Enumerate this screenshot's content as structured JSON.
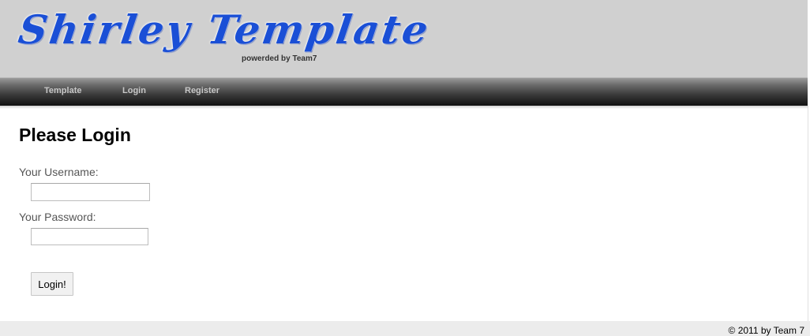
{
  "header": {
    "logo_title": "Shirley Template",
    "logo_subtitle": "powerded by Team7"
  },
  "nav": {
    "items": [
      {
        "label": "Template"
      },
      {
        "label": "Login"
      },
      {
        "label": "Register"
      }
    ]
  },
  "main": {
    "title": "Please Login",
    "username_label": "Your Username:",
    "username_value": "",
    "password_label": "Your Password:",
    "password_value": "",
    "submit_label": "Login!"
  },
  "footer": {
    "text": "© 2011 by Team 7"
  },
  "colors": {
    "logo_blue": "#1a4fd6",
    "header_bg": "#d0d0d0",
    "nav_text": "#c8c8c8",
    "footer_bg": "#ececec"
  }
}
